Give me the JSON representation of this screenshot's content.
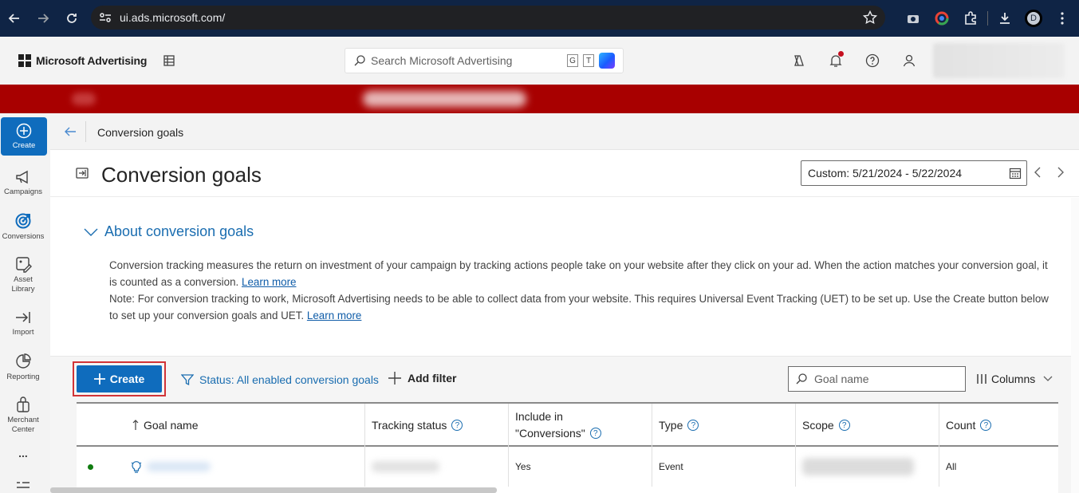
{
  "browser": {
    "url": "ui.ads.microsoft.com/",
    "profile_initial": "D"
  },
  "header": {
    "brand": "Microsoft Advertising",
    "search_placeholder": "Search Microsoft Advertising",
    "shortcut_keys": [
      "G",
      "T"
    ]
  },
  "rail": {
    "items": [
      {
        "label": "Create",
        "icon": "plus-circle-icon"
      },
      {
        "label": "Campaigns",
        "icon": "megaphone-icon"
      },
      {
        "label": "Conversions",
        "icon": "target-icon"
      },
      {
        "label": "Asset Library",
        "icon": "image-edit-icon"
      },
      {
        "label": "Import",
        "icon": "import-arrow-icon"
      },
      {
        "label": "Reporting",
        "icon": "chart-report-icon"
      },
      {
        "label": "Merchant Center",
        "icon": "shopping-bag-icon"
      },
      {
        "label": "...",
        "icon": "more-icon"
      }
    ]
  },
  "breadcrumb": {
    "current": "Conversion goals"
  },
  "page": {
    "title": "Conversion goals",
    "date_range": "Custom: 5/21/2024 - 5/22/2024"
  },
  "about": {
    "heading": "About conversion goals",
    "line1": "Conversion tracking measures the return on investment of your campaign by tracking actions people take on your website after they click on your ad. When the action matches your conversion goal, it is counted as a conversion.",
    "link1": "Learn more",
    "line2": "Note: For conversion tracking to work, Microsoft Advertising needs to be able to collect data from your website. This requires Universal Event Tracking (UET) to be set up. Use the Create button below to set up your conversion goals and UET.",
    "link2": "Learn more"
  },
  "toolbar": {
    "create_label": "Create",
    "status_filter": "Status: All enabled conversion goals",
    "add_filter": "Add filter",
    "goal_search_placeholder": "Goal name",
    "columns_label": "Columns"
  },
  "table": {
    "headers": {
      "goal_name": "Goal name",
      "tracking_status": "Tracking status",
      "include_line1": "Include in",
      "include_line2": "\"Conversions\"",
      "type": "Type",
      "scope": "Scope",
      "count": "Count"
    },
    "rows": [
      {
        "include": "Yes",
        "type": "Event",
        "count": "All"
      }
    ]
  },
  "colors": {
    "accent": "#0f6cbd",
    "banner": "#a80000",
    "link": "#1a6db0",
    "highlight_outline": "#d13438"
  }
}
